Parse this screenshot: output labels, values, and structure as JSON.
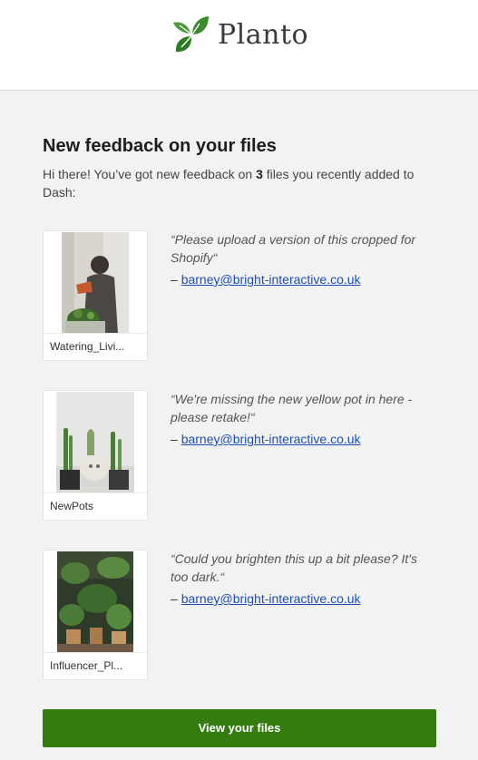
{
  "brand": {
    "name": "Planto",
    "leaf_color": "#3c8a2e"
  },
  "email": {
    "heading": "New feedback on your files",
    "intro_before": "Hi there! You’ve got new feedback on ",
    "intro_count": "3",
    "intro_after": " files you recently added to Dash:"
  },
  "feedback": [
    {
      "filename": "Watering_Livi...",
      "comment": "“Please upload a version of this cropped for Shopify“",
      "dash": "– ",
      "author": "barney@bright-interactive.co.uk"
    },
    {
      "filename": "NewPots",
      "comment": "“We're missing the new yellow pot in here - please retake!“",
      "dash": "– ",
      "author": "barney@bright-interactive.co.uk"
    },
    {
      "filename": "Influencer_Pl...",
      "comment": "“Could you brighten this up a bit please? It's too dark.“",
      "dash": "– ",
      "author": "barney@bright-interactive.co.uk"
    }
  ],
  "cta": {
    "label": "View your files",
    "color": "#357c10"
  },
  "icons": {
    "logo": "leaf-logo-icon"
  }
}
